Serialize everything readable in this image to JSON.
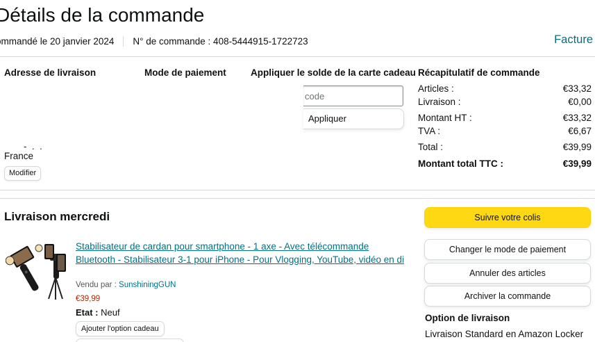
{
  "header": {
    "title": "Détails de la commande",
    "order_date": "ommandé le 20 janvier 2024",
    "order_number": "N° de commande : 408-5444915-1722723",
    "invoice_link": "Facture"
  },
  "columns": {
    "shipping_address": "Adresse de livraison",
    "payment_method": "Mode de paiement",
    "gift_card": "Appliquer le solde de la carte cadeau",
    "summary": "Récapitulatif de commande"
  },
  "gift_card": {
    "placeholder": "code",
    "apply_label": "Appliquer"
  },
  "address": {
    "fragment": "- .  .",
    "country": "France",
    "modify_label": "Modifier"
  },
  "summary": {
    "rows": [
      {
        "label": "Articles :",
        "value": "€33,32"
      },
      {
        "label": "Livraison :",
        "value": "€0,00"
      },
      {
        "label": "Montant HT :",
        "value": "€33,32"
      },
      {
        "label": "TVA :",
        "value": "€6,67"
      },
      {
        "label": "Total :",
        "value": "€39,99"
      }
    ],
    "grand_total_label": "Montant total TTC :",
    "grand_total_value": "€39,99"
  },
  "delivery": {
    "title": "Livraison mercredi"
  },
  "product": {
    "image_icon": "gimbal-stabilizer-image",
    "title": "Stabilisateur de cardan pour smartphone - 1 axe - Avec télécommande Bluetooth - Stabilisateur 3-1 pour iPhone - Pour Vlogging, YouTube, vidéo en di",
    "seller_prefix": "Vendu par :",
    "seller_name": "SunshiningGUN",
    "price": "€39,99",
    "condition_label": "Etat :",
    "condition_value": "Neuf",
    "gift_option_label": "Ajouter l'option cadeau"
  },
  "actions": {
    "track": "Suivre votre colis",
    "change_payment": "Changer le mode de paiement",
    "cancel_items": "Annuler des articles",
    "archive": "Archiver la commande"
  },
  "shipping_option": {
    "title": "Option de livraison",
    "value": "Livraison Standard en Amazon Locker"
  },
  "colors": {
    "link": "#007185",
    "price": "#B12704",
    "primary_button": "#FFD814",
    "border": "#D5D9D9"
  }
}
